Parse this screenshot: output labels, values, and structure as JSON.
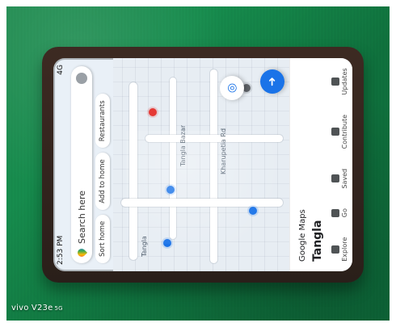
{
  "photo": {
    "watermark": {
      "text": "vivo V23e",
      "small": "5G"
    }
  },
  "maps": {
    "status": {
      "time": "2:53 PM",
      "right": "4G"
    },
    "search": {
      "placeholder": "Search here"
    },
    "chips": [
      {
        "label": "Sort home"
      },
      {
        "label": "Add to home"
      },
      {
        "label": "Restaurants"
      }
    ],
    "labels": [
      {
        "text": "Tangla"
      },
      {
        "text": "Google Maps"
      },
      {
        "text": "Bazar"
      },
      {
        "text": "Tangla Bazar"
      },
      {
        "text": "Kharupetia Rd"
      }
    ],
    "bottom": {
      "title": "Google Maps",
      "subtitle": "Tangla",
      "nav": [
        {
          "label": "Explore"
        },
        {
          "label": "Go"
        },
        {
          "label": "Saved"
        },
        {
          "label": "Contribute"
        },
        {
          "label": "Updates"
        }
      ]
    },
    "system_keys": [
      "■",
      "●",
      "◀"
    ]
  }
}
